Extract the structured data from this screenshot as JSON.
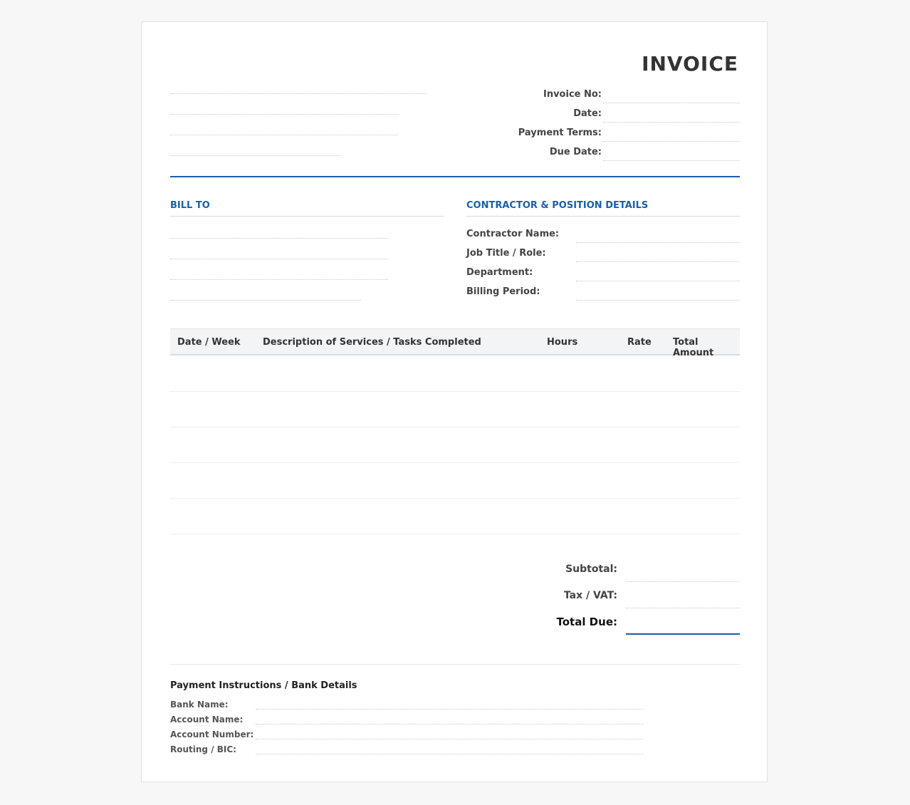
{
  "invoice": {
    "title": "INVOICE",
    "meta_fields": [
      {
        "label": "Invoice No:",
        "value": ""
      },
      {
        "label": "Date:",
        "value": ""
      },
      {
        "label": "Payment Terms:",
        "value": ""
      },
      {
        "label": "Due Date:",
        "value": ""
      }
    ]
  },
  "bill_to": {
    "title": "BILL TO"
  },
  "contractor": {
    "title": "CONTRACTOR & POSITION DETAILS",
    "fields": [
      {
        "label": "Contractor Name:",
        "value": ""
      },
      {
        "label": "Job Title / Role:",
        "value": ""
      },
      {
        "label": "Department:",
        "value": ""
      },
      {
        "label": "Billing Period:",
        "value": ""
      }
    ]
  },
  "table": {
    "columns": [
      "Date / Week",
      "Description of Services / Tasks Completed",
      "Hours",
      "Rate",
      "Total Amount"
    ]
  },
  "totals": {
    "subtotal_label": "Subtotal:",
    "tax_label": "Tax / VAT:",
    "total_label": "Total Due:"
  },
  "payment": {
    "title": "Payment Instructions / Bank Details",
    "fields": [
      {
        "label": "Bank Name:",
        "value": ""
      },
      {
        "label": "Account Name:",
        "value": ""
      },
      {
        "label": "Account Number:",
        "value": ""
      },
      {
        "label": "Routing / BIC:",
        "value": ""
      }
    ]
  },
  "colors": {
    "accent": "#1a5fa8",
    "page_bg": "#f7f7f7",
    "sheet_bg": "#ffffff"
  }
}
